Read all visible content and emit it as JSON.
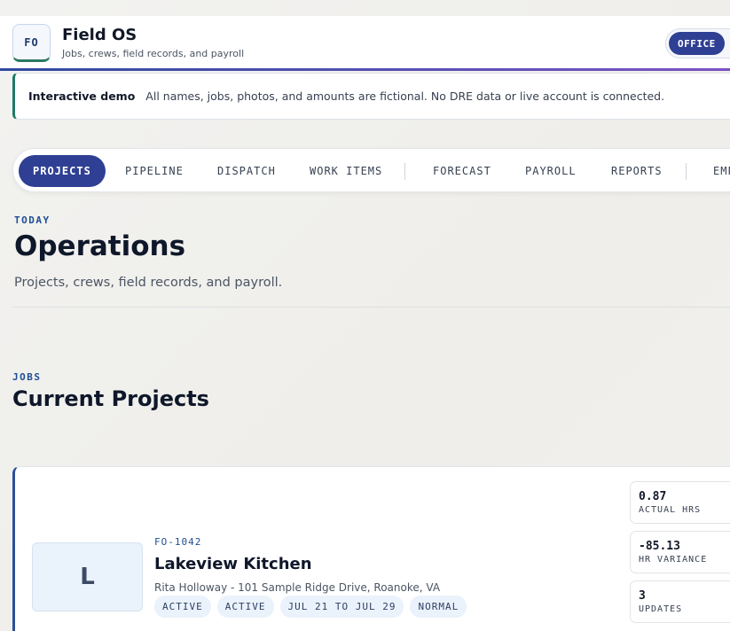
{
  "app": {
    "logo": "FO",
    "title": "Field OS",
    "subtitle": "Jobs, crews, field records, and payroll",
    "role": "OFFICE"
  },
  "banner": {
    "title": "Interactive demo",
    "text": "All names, jobs, photos, and amounts are fictional. No DRE data or live account is connected."
  },
  "tabs": [
    {
      "label": "PROJECTS",
      "active": true
    },
    {
      "label": "PIPELINE"
    },
    {
      "label": "DISPATCH"
    },
    {
      "label": "WORK ITEMS"
    },
    {
      "label": "FORECAST"
    },
    {
      "label": "PAYROLL"
    },
    {
      "label": "REPORTS"
    },
    {
      "label": "EMP"
    }
  ],
  "page": {
    "eyebrow": "TODAY",
    "title": "Operations",
    "subtitle": "Projects, crews, field records, and payroll."
  },
  "section": {
    "eyebrow": "JOBS",
    "title": "Current Projects"
  },
  "project": {
    "avatar": "L",
    "id": "FO-1042",
    "name": "Lakeview Kitchen",
    "meta": "Rita Holloway - 101 Sample Ridge Drive, Roanoke, VA",
    "tags": [
      "ACTIVE",
      "ACTIVE",
      "JUL 21 TO JUL 29",
      "NORMAL"
    ],
    "stats": [
      {
        "value": "0.87",
        "label": "ACTUAL HRS"
      },
      {
        "value": "-85.13",
        "label": "HR VARIANCE"
      },
      {
        "value": "3",
        "label": "UPDATES"
      }
    ]
  }
}
